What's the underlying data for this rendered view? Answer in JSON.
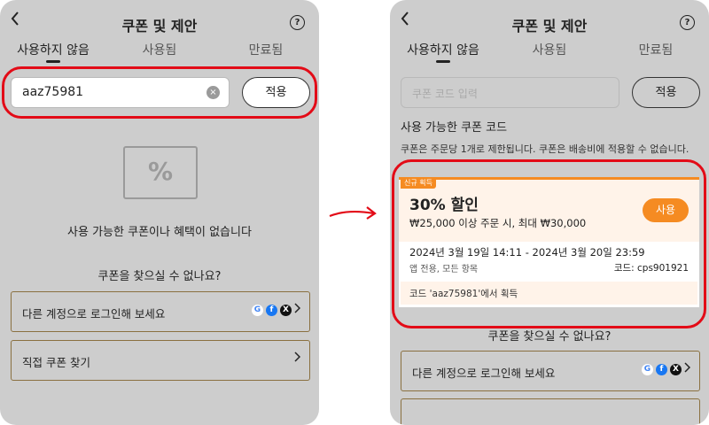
{
  "left": {
    "header": {
      "title": "쿠폰 및 제안",
      "back_icon": "chevron-left-icon",
      "help_icon": "question-circle-icon",
      "help_glyph": "?"
    },
    "tabs": [
      {
        "label": "사용하지 않음"
      },
      {
        "label": "사용됨"
      },
      {
        "label": "만료됨"
      }
    ],
    "input": {
      "value": "aaz75981",
      "clear_glyph": "×"
    },
    "apply_label": "적용",
    "empty": {
      "icon": "percent-coupon-icon",
      "glyph": "%",
      "message": "사용 가능한 쿠폰이나 혜택이 없습니다"
    },
    "find_heading": "쿠폰을 찾으실 수 없나요?",
    "login_row": "다른 계정으로 로그인해 보세요",
    "direct_row": "직접 쿠폰 찾기",
    "social": {
      "google": "G",
      "facebook": "f",
      "x": "X"
    }
  },
  "right": {
    "header": {
      "title": "쿠폰 및 제안",
      "help_glyph": "?"
    },
    "tabs": [
      {
        "label": "사용하지 않음"
      },
      {
        "label": "사용됨"
      },
      {
        "label": "만료됨"
      }
    ],
    "input": {
      "placeholder": "쿠폰 코드 입력"
    },
    "apply_label": "적용",
    "section_title": "사용 가능한 쿠폰 코드",
    "section_note": "쿠폰은 주문당 1개로 제한됩니다. 쿠폰은 배송비에 적용할 수 없습니다.",
    "coupon": {
      "badge": "신규 획득",
      "discount": "30% 할인",
      "condition": "₩25,000 이상 주문 시, 최대 ₩30,000",
      "use_label": "사용",
      "dates": "2024년 3월 19일 14:11 - 2024년 3월 20일 23:59",
      "scope": "앱 전용, 모든 항목",
      "code": "코드: cps901921",
      "acquired": "코드 'aaz75981'에서 획득"
    },
    "find_heading": "쿠폰을 찾으실 수 없나요?",
    "login_row": "다른 계정으로 로그인해 보세요",
    "social": {
      "google": "G",
      "facebook": "f",
      "x": "X"
    }
  },
  "colors": {
    "accent": "#f58b22",
    "highlight": "#e30b17",
    "overlay": "#cdcdcd"
  }
}
